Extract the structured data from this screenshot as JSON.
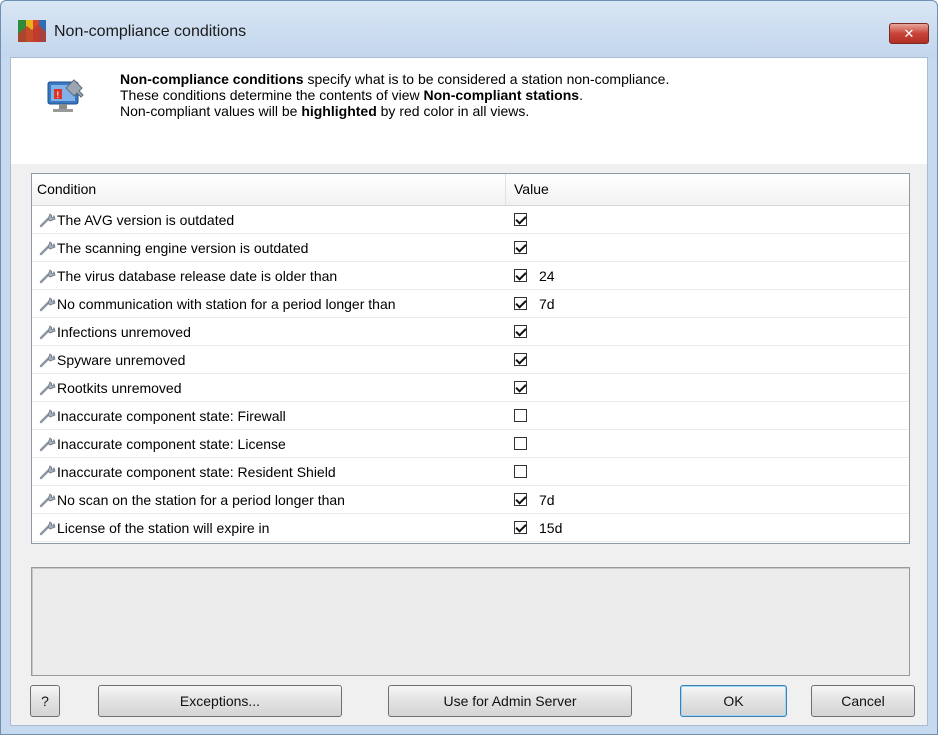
{
  "window": {
    "title": "Non-compliance conditions",
    "close_label": "✕"
  },
  "header": {
    "line1_bold": "Non-compliance conditions",
    "line1_rest": " specify what is to be considered a station non-compliance.",
    "line2_start": "These conditions determine the contents of view ",
    "line2_bold": "Non-compliant stations",
    "line2_end": ".",
    "line3_start": "Non-compliant values will be ",
    "line3_bold": "highlighted",
    "line3_end": " by red color in all views."
  },
  "grid": {
    "col_condition": "Condition",
    "col_value": "Value",
    "rows": [
      {
        "label": "The AVG version is outdated",
        "checked": true,
        "value": ""
      },
      {
        "label": "The scanning engine version is outdated",
        "checked": true,
        "value": ""
      },
      {
        "label": "The virus database release date is older than",
        "checked": true,
        "value": "24"
      },
      {
        "label": "No communication with station for a period longer than",
        "checked": true,
        "value": "7d"
      },
      {
        "label": "Infections unremoved",
        "checked": true,
        "value": ""
      },
      {
        "label": "Spyware unremoved",
        "checked": true,
        "value": ""
      },
      {
        "label": "Rootkits unremoved",
        "checked": true,
        "value": ""
      },
      {
        "label": "Inaccurate component state: Firewall",
        "checked": false,
        "value": ""
      },
      {
        "label": "Inaccurate component state: License",
        "checked": false,
        "value": ""
      },
      {
        "label": "Inaccurate component state: Resident Shield",
        "checked": false,
        "value": ""
      },
      {
        "label": "No scan on the station for a period longer than",
        "checked": true,
        "value": "7d"
      },
      {
        "label": "License of the station will expire in",
        "checked": true,
        "value": "15d"
      }
    ]
  },
  "buttons": {
    "help": "?",
    "exceptions": "Exceptions...",
    "use_admin": "Use for Admin Server",
    "ok": "OK",
    "cancel": "Cancel"
  },
  "icons": {
    "app_logo": "avg-logo-icon",
    "header": "computer-settings-icon",
    "row": "wrench-icon"
  },
  "colors": {
    "accent": "#3c7fb1",
    "close": "#c8443a"
  }
}
